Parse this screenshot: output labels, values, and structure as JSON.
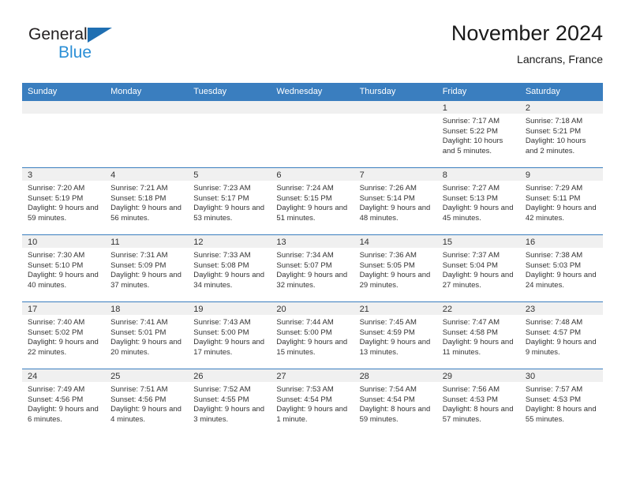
{
  "brand": {
    "name_top": "General",
    "name_bottom": "Blue",
    "triangle_color": "#1f6fb2",
    "blue_text_color": "#2b8fd6"
  },
  "header": {
    "title": "November 2024",
    "subtitle": "Lancrans, France"
  },
  "theme": {
    "header_row_bg": "#3a7ebf",
    "header_row_text": "#ffffff",
    "daynum_band_bg": "#f0f0f0",
    "row_divider": "#3a7ebf",
    "body_text": "#333333"
  },
  "weekday_headers": [
    "Sunday",
    "Monday",
    "Tuesday",
    "Wednesday",
    "Thursday",
    "Friday",
    "Saturday"
  ],
  "labels": {
    "sunrise_prefix": "Sunrise:",
    "sunset_prefix": "Sunset:",
    "daylight_prefix": "Daylight:"
  },
  "weeks": [
    [
      {
        "empty": true
      },
      {
        "empty": true
      },
      {
        "empty": true
      },
      {
        "empty": true
      },
      {
        "empty": true
      },
      {
        "empty": false,
        "day": "1",
        "sunrise": "Sunrise: 7:17 AM",
        "sunset": "Sunset: 5:22 PM",
        "daylight": "Daylight: 10 hours and 5 minutes."
      },
      {
        "empty": false,
        "day": "2",
        "sunrise": "Sunrise: 7:18 AM",
        "sunset": "Sunset: 5:21 PM",
        "daylight": "Daylight: 10 hours and 2 minutes."
      }
    ],
    [
      {
        "empty": false,
        "day": "3",
        "sunrise": "Sunrise: 7:20 AM",
        "sunset": "Sunset: 5:19 PM",
        "daylight": "Daylight: 9 hours and 59 minutes."
      },
      {
        "empty": false,
        "day": "4",
        "sunrise": "Sunrise: 7:21 AM",
        "sunset": "Sunset: 5:18 PM",
        "daylight": "Daylight: 9 hours and 56 minutes."
      },
      {
        "empty": false,
        "day": "5",
        "sunrise": "Sunrise: 7:23 AM",
        "sunset": "Sunset: 5:17 PM",
        "daylight": "Daylight: 9 hours and 53 minutes."
      },
      {
        "empty": false,
        "day": "6",
        "sunrise": "Sunrise: 7:24 AM",
        "sunset": "Sunset: 5:15 PM",
        "daylight": "Daylight: 9 hours and 51 minutes."
      },
      {
        "empty": false,
        "day": "7",
        "sunrise": "Sunrise: 7:26 AM",
        "sunset": "Sunset: 5:14 PM",
        "daylight": "Daylight: 9 hours and 48 minutes."
      },
      {
        "empty": false,
        "day": "8",
        "sunrise": "Sunrise: 7:27 AM",
        "sunset": "Sunset: 5:13 PM",
        "daylight": "Daylight: 9 hours and 45 minutes."
      },
      {
        "empty": false,
        "day": "9",
        "sunrise": "Sunrise: 7:29 AM",
        "sunset": "Sunset: 5:11 PM",
        "daylight": "Daylight: 9 hours and 42 minutes."
      }
    ],
    [
      {
        "empty": false,
        "day": "10",
        "sunrise": "Sunrise: 7:30 AM",
        "sunset": "Sunset: 5:10 PM",
        "daylight": "Daylight: 9 hours and 40 minutes."
      },
      {
        "empty": false,
        "day": "11",
        "sunrise": "Sunrise: 7:31 AM",
        "sunset": "Sunset: 5:09 PM",
        "daylight": "Daylight: 9 hours and 37 minutes."
      },
      {
        "empty": false,
        "day": "12",
        "sunrise": "Sunrise: 7:33 AM",
        "sunset": "Sunset: 5:08 PM",
        "daylight": "Daylight: 9 hours and 34 minutes."
      },
      {
        "empty": false,
        "day": "13",
        "sunrise": "Sunrise: 7:34 AM",
        "sunset": "Sunset: 5:07 PM",
        "daylight": "Daylight: 9 hours and 32 minutes."
      },
      {
        "empty": false,
        "day": "14",
        "sunrise": "Sunrise: 7:36 AM",
        "sunset": "Sunset: 5:05 PM",
        "daylight": "Daylight: 9 hours and 29 minutes."
      },
      {
        "empty": false,
        "day": "15",
        "sunrise": "Sunrise: 7:37 AM",
        "sunset": "Sunset: 5:04 PM",
        "daylight": "Daylight: 9 hours and 27 minutes."
      },
      {
        "empty": false,
        "day": "16",
        "sunrise": "Sunrise: 7:38 AM",
        "sunset": "Sunset: 5:03 PM",
        "daylight": "Daylight: 9 hours and 24 minutes."
      }
    ],
    [
      {
        "empty": false,
        "day": "17",
        "sunrise": "Sunrise: 7:40 AM",
        "sunset": "Sunset: 5:02 PM",
        "daylight": "Daylight: 9 hours and 22 minutes."
      },
      {
        "empty": false,
        "day": "18",
        "sunrise": "Sunrise: 7:41 AM",
        "sunset": "Sunset: 5:01 PM",
        "daylight": "Daylight: 9 hours and 20 minutes."
      },
      {
        "empty": false,
        "day": "19",
        "sunrise": "Sunrise: 7:43 AM",
        "sunset": "Sunset: 5:00 PM",
        "daylight": "Daylight: 9 hours and 17 minutes."
      },
      {
        "empty": false,
        "day": "20",
        "sunrise": "Sunrise: 7:44 AM",
        "sunset": "Sunset: 5:00 PM",
        "daylight": "Daylight: 9 hours and 15 minutes."
      },
      {
        "empty": false,
        "day": "21",
        "sunrise": "Sunrise: 7:45 AM",
        "sunset": "Sunset: 4:59 PM",
        "daylight": "Daylight: 9 hours and 13 minutes."
      },
      {
        "empty": false,
        "day": "22",
        "sunrise": "Sunrise: 7:47 AM",
        "sunset": "Sunset: 4:58 PM",
        "daylight": "Daylight: 9 hours and 11 minutes."
      },
      {
        "empty": false,
        "day": "23",
        "sunrise": "Sunrise: 7:48 AM",
        "sunset": "Sunset: 4:57 PM",
        "daylight": "Daylight: 9 hours and 9 minutes."
      }
    ],
    [
      {
        "empty": false,
        "day": "24",
        "sunrise": "Sunrise: 7:49 AM",
        "sunset": "Sunset: 4:56 PM",
        "daylight": "Daylight: 9 hours and 6 minutes."
      },
      {
        "empty": false,
        "day": "25",
        "sunrise": "Sunrise: 7:51 AM",
        "sunset": "Sunset: 4:56 PM",
        "daylight": "Daylight: 9 hours and 4 minutes."
      },
      {
        "empty": false,
        "day": "26",
        "sunrise": "Sunrise: 7:52 AM",
        "sunset": "Sunset: 4:55 PM",
        "daylight": "Daylight: 9 hours and 3 minutes."
      },
      {
        "empty": false,
        "day": "27",
        "sunrise": "Sunrise: 7:53 AM",
        "sunset": "Sunset: 4:54 PM",
        "daylight": "Daylight: 9 hours and 1 minute."
      },
      {
        "empty": false,
        "day": "28",
        "sunrise": "Sunrise: 7:54 AM",
        "sunset": "Sunset: 4:54 PM",
        "daylight": "Daylight: 8 hours and 59 minutes."
      },
      {
        "empty": false,
        "day": "29",
        "sunrise": "Sunrise: 7:56 AM",
        "sunset": "Sunset: 4:53 PM",
        "daylight": "Daylight: 8 hours and 57 minutes."
      },
      {
        "empty": false,
        "day": "30",
        "sunrise": "Sunrise: 7:57 AM",
        "sunset": "Sunset: 4:53 PM",
        "daylight": "Daylight: 8 hours and 55 minutes."
      }
    ]
  ]
}
